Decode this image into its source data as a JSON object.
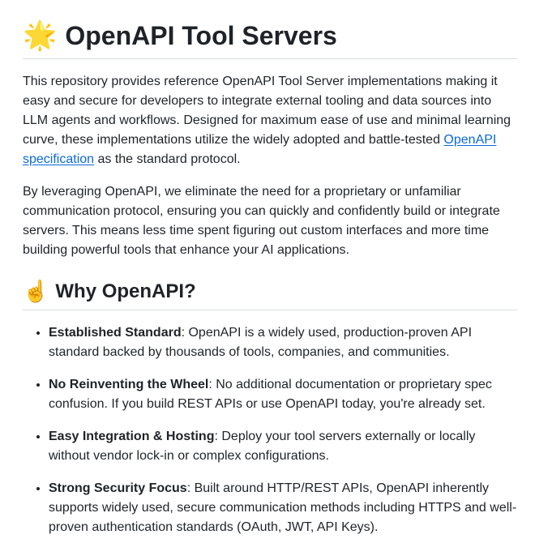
{
  "title": {
    "emoji": "🌟",
    "text": "OpenAPI Tool Servers"
  },
  "intro": {
    "p1_before": "This repository provides reference OpenAPI Tool Server implementations making it easy and secure for developers to integrate external tooling and data sources into LLM agents and workflows. Designed for maximum ease of use and minimal learning curve, these implementations utilize the widely adopted and battle-tested ",
    "p1_link": "OpenAPI specification",
    "p1_after": " as the standard protocol.",
    "p2": "By leveraging OpenAPI, we eliminate the need for a proprietary or unfamiliar communication protocol, ensuring you can quickly and confidently build or integrate servers. This means less time spent figuring out custom interfaces and more time building powerful tools that enhance your AI applications."
  },
  "why": {
    "emoji": "☝️",
    "heading": "Why OpenAPI?",
    "items": [
      {
        "term": "Established Standard",
        "desc": ": OpenAPI is a widely used, production-proven API standard backed by thousands of tools, companies, and communities."
      },
      {
        "term": "No Reinventing the Wheel",
        "desc": ": No additional documentation or proprietary spec confusion. If you build REST APIs or use OpenAPI today, you're already set."
      },
      {
        "term": "Easy Integration & Hosting",
        "desc": ": Deploy your tool servers externally or locally without vendor lock-in or complex configurations."
      },
      {
        "term": "Strong Security Focus",
        "desc": ": Built around HTTP/REST APIs, OpenAPI inherently supports widely used, secure communication methods including HTTPS and well-proven authentication standards (OAuth, JWT, API Keys)."
      }
    ]
  }
}
